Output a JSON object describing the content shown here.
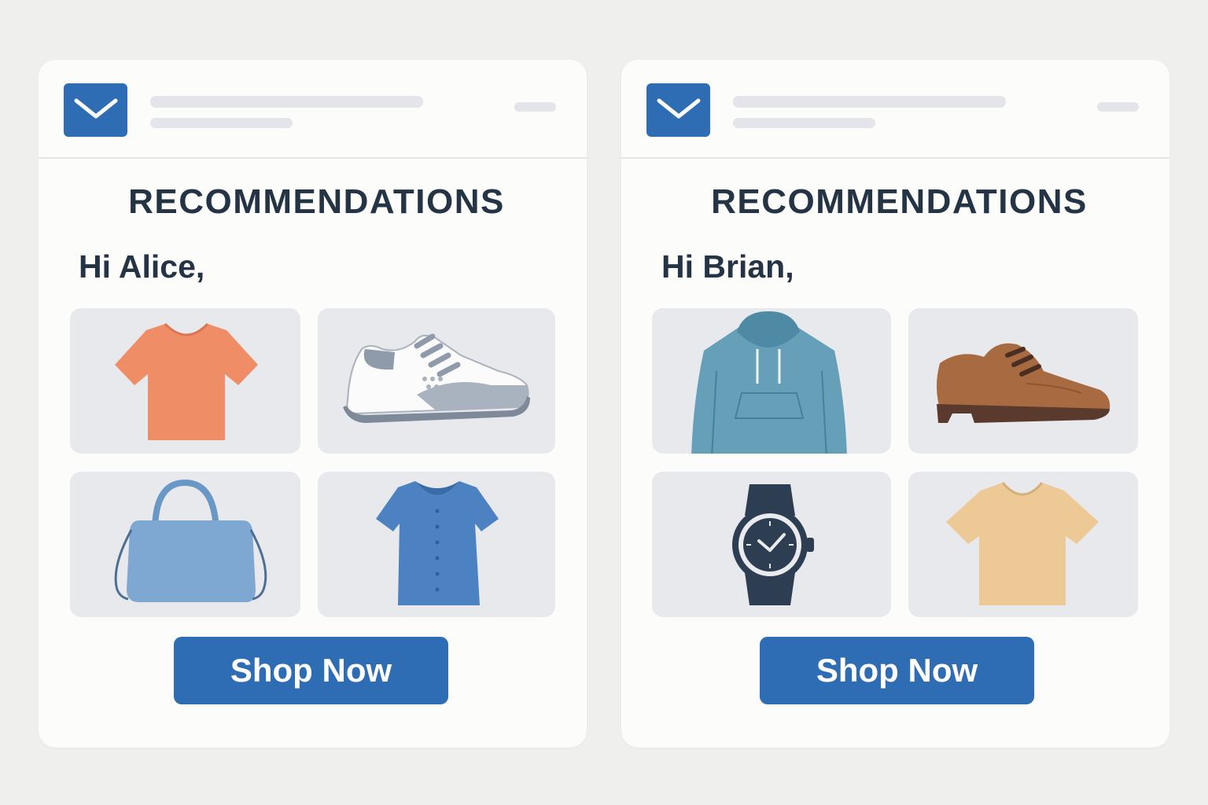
{
  "colors": {
    "page_background": "#efefed",
    "card_background": "#fcfcfb",
    "accent": "#2e6db4",
    "text": "#253445",
    "tile_background": "#e8e9ed"
  },
  "emails": [
    {
      "icon": "mail-icon",
      "title": "RECOMMENDATIONS",
      "greeting": "Hi Alice,",
      "products": [
        {
          "icon": "orange-tshirt-icon"
        },
        {
          "icon": "white-sneaker-icon"
        },
        {
          "icon": "blue-handbag-icon"
        },
        {
          "icon": "blue-blouse-icon"
        }
      ],
      "cta_label": "Shop Now"
    },
    {
      "icon": "mail-icon",
      "title": "RECOMMENDATIONS",
      "greeting": "Hi Brian,",
      "products": [
        {
          "icon": "teal-hoodie-icon"
        },
        {
          "icon": "brown-shoe-icon"
        },
        {
          "icon": "wristwatch-icon"
        },
        {
          "icon": "beige-tshirt-icon"
        }
      ],
      "cta_label": "Shop Now"
    }
  ]
}
